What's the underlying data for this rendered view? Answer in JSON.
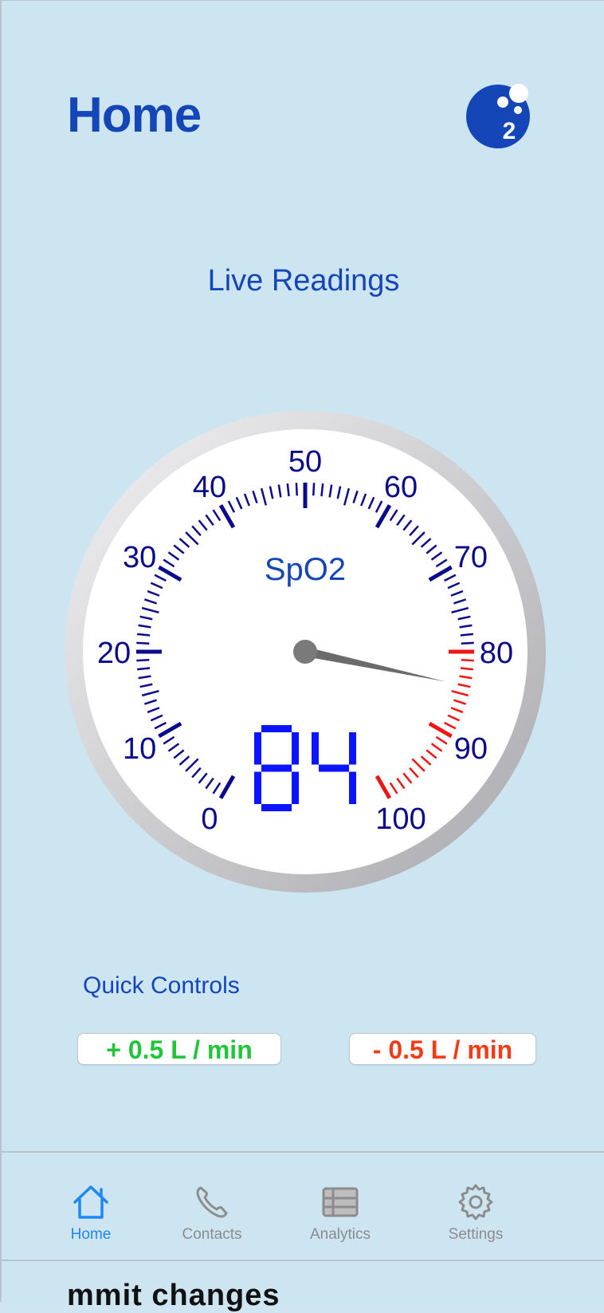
{
  "header": {
    "title": "Home",
    "logo_digit": "2"
  },
  "live": {
    "title": "Live Readings"
  },
  "gauge": {
    "label": "SpO2",
    "value": 84,
    "display": "84",
    "min": 0,
    "max": 100,
    "tick_labels": [
      "0",
      "10",
      "20",
      "30",
      "40",
      "50",
      "60",
      "70",
      "80",
      "90",
      "100"
    ],
    "warning_start": 80,
    "colors": {
      "normal": "#0b0a8a",
      "warning": "#f01414",
      "digits": "#0a14ff"
    }
  },
  "quick": {
    "title": "Quick Controls",
    "increase_label": "+ 0.5 L / min",
    "decrease_label": "- 0.5 L / min"
  },
  "tabs": [
    {
      "label": "Home",
      "icon": "home-icon",
      "active": true
    },
    {
      "label": "Contacts",
      "icon": "phone-icon",
      "active": false
    },
    {
      "label": "Analytics",
      "icon": "table-icon",
      "active": false
    },
    {
      "label": "Settings",
      "icon": "gear-icon",
      "active": false
    }
  ],
  "footer": {
    "clipped_text": "mmit changes"
  }
}
